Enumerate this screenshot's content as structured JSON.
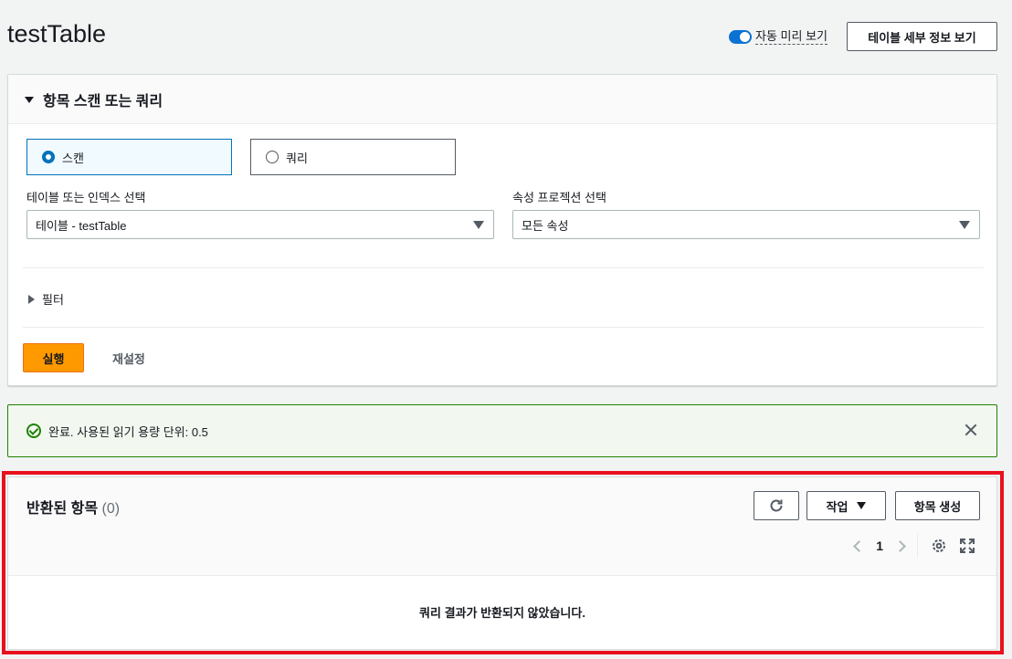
{
  "header": {
    "title": "testTable",
    "auto_preview_label": "자동 미리 보기",
    "details_button": "테이블 세부 정보 보기"
  },
  "scan_panel": {
    "title": "항목 스캔 또는 쿼리",
    "options": [
      "스캔",
      "쿼리"
    ],
    "selected_option": "스캔",
    "table_label": "테이블 또는 인덱스 선택",
    "table_value": "테이블 - testTable",
    "projection_label": "속성 프로젝션 선택",
    "projection_value": "모든 속성",
    "filter_label": "필터",
    "run_button": "실행",
    "reset_button": "재설정"
  },
  "alert": {
    "message": "완료. 사용된 읽기 용량 단위: 0.5",
    "status_color": "#1d8102"
  },
  "results": {
    "title": "반환된 항목",
    "count": "(0)",
    "actions_button": "작업",
    "create_button": "항목 생성",
    "page": "1",
    "empty_message": "쿼리 결과가 반환되지 않았습니다."
  },
  "colors": {
    "accent": "#0073bb",
    "primary_button": "#ff9900",
    "highlight_border": "#e8101e"
  }
}
